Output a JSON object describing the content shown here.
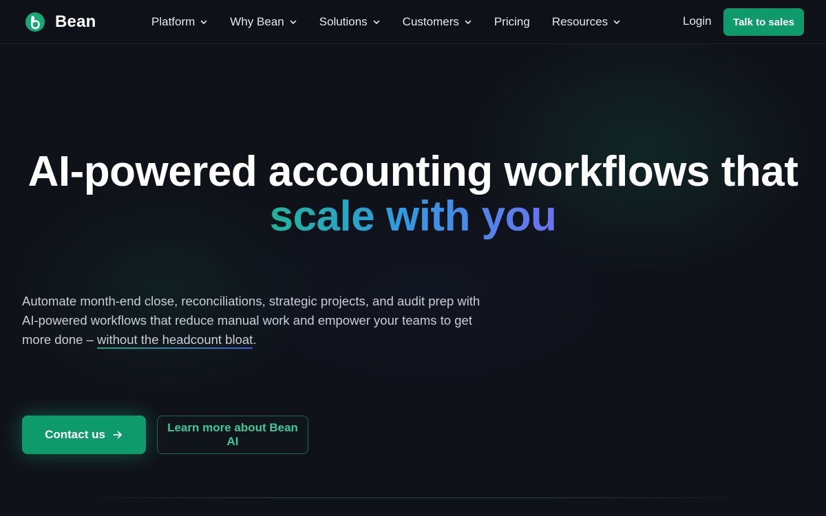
{
  "header": {
    "logo_text": "Bean",
    "nav": [
      {
        "label": "Platform",
        "has_dropdown": true
      },
      {
        "label": "Why Bean",
        "has_dropdown": true
      },
      {
        "label": "Solutions",
        "has_dropdown": true
      },
      {
        "label": "Customers",
        "has_dropdown": true
      },
      {
        "label": "Pricing",
        "has_dropdown": false
      },
      {
        "label": "Resources",
        "has_dropdown": true
      }
    ],
    "login_label": "Login",
    "cta_label": "Talk to sales"
  },
  "hero": {
    "headline_line1": "AI-powered accounting workflows that",
    "headline_accent": "scale with you",
    "subcopy_text": "Automate month-end close, reconciliations, strategic projects, and audit prep with AI-powered workflows that reduce manual work and empower your teams to get more done – ",
    "subcopy_link": "without the headcount bloat",
    "subcopy_end": ".",
    "primary_cta": "Contact us",
    "secondary_cta": "Learn more about Bean AI"
  },
  "colors": {
    "background": "#10121a",
    "brand_green": "#0f9a6c",
    "accent_green": "#3cc99a",
    "gradient_start": "#22b39a",
    "gradient_mid": "#2f9be0",
    "gradient_end": "#6c72f0"
  },
  "icons": {
    "logo": "bean-logo-icon",
    "dropdown": "chevron-down-icon",
    "cta_arrow": "arrow-right-icon"
  }
}
